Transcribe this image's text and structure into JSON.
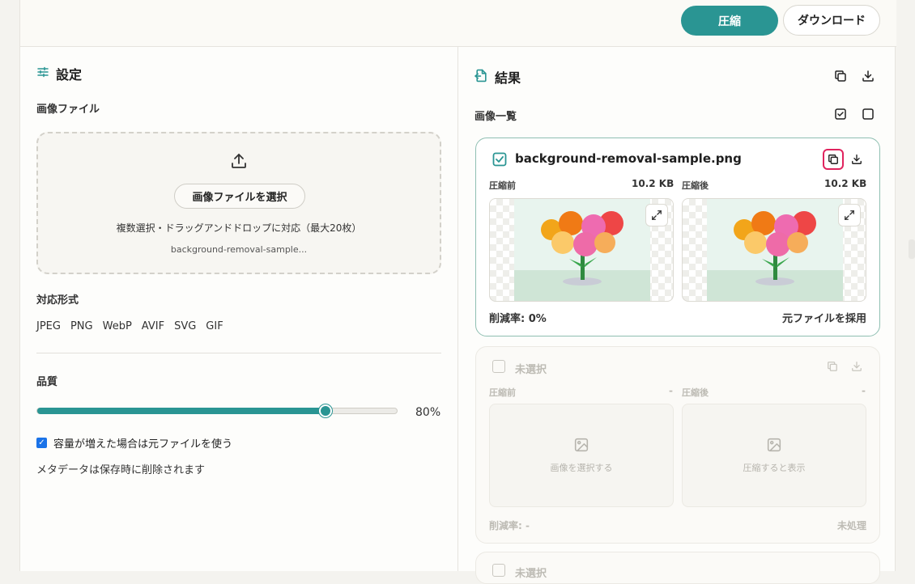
{
  "toolbar": {
    "compress_label": "圧縮",
    "download_label": "ダウンロード"
  },
  "settings": {
    "title": "設定",
    "image_file_label": "画像ファイル",
    "select_button": "画像ファイルを選択",
    "drop_hint": "複数選択・ドラッグアンドドロップに対応（最大20枚）",
    "selected_file": "background-removal-sample...",
    "formats_label": "対応形式",
    "formats": [
      "JPEG",
      "PNG",
      "WebP",
      "AVIF",
      "SVG",
      "GIF"
    ],
    "quality_label": "品質",
    "quality_value": 80,
    "quality_text": "80%",
    "fallback_checkbox_label": "容量が増えた場合は元ファイルを使う",
    "fallback_checked": true,
    "metadata_note": "メタデータは保存時に削除されます"
  },
  "results": {
    "title": "結果",
    "list_label": "画像一覧",
    "card": {
      "filename": "background-removal-sample.png",
      "checked": true,
      "before_label": "圧縮前",
      "before_size": "10.2 KB",
      "after_label": "圧縮後",
      "after_size": "10.2 KB",
      "reduction": "削減率: 0%",
      "status": "元ファイルを採用"
    },
    "empty_card": {
      "label": "未選択",
      "before_label": "圧縮前",
      "before_size": "-",
      "after_label": "圧縮後",
      "after_size": "-",
      "before_placeholder": "画像を選択する",
      "after_placeholder": "圧縮すると表示",
      "reduction": "削減率: -",
      "status": "未処理"
    },
    "empty_card2": {
      "label": "未選択"
    }
  },
  "colors": {
    "accent": "#2a9593",
    "highlight": "#e0245e"
  }
}
